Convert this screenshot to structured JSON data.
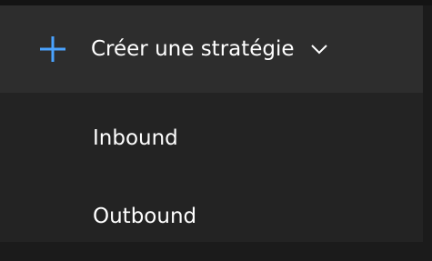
{
  "split_button": {
    "label": "Créer une stratégie",
    "icons": {
      "plus": "plus-icon",
      "chevron": "chevron-down-icon"
    }
  },
  "menu": {
    "items": [
      {
        "label": "Inbound"
      },
      {
        "label": "Outbound"
      }
    ]
  },
  "colors": {
    "accent": "#4aa3ff",
    "menu_background": "#232323",
    "button_background": "#2d2d2d",
    "text": "#ffffff"
  }
}
